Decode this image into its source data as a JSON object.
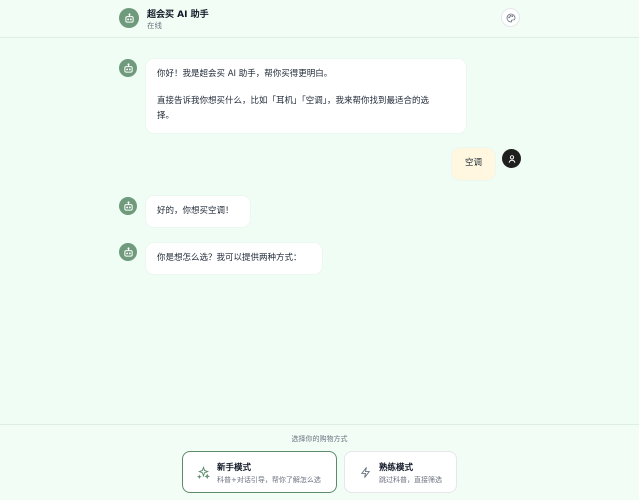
{
  "header": {
    "title": "超会买 AI 助手",
    "status": "在线"
  },
  "messages": [
    {
      "role": "assistant",
      "lines": [
        "你好！我是超会买 AI 助手，帮你买得更明白。",
        "",
        "直接告诉我你想买什么，比如「耳机」「空调」，我来帮你找到最适合的选",
        "择。"
      ]
    },
    {
      "role": "user",
      "text": "空调"
    },
    {
      "role": "assistant",
      "text": "好的，你想买空调！"
    },
    {
      "role": "assistant",
      "text": "你是想怎么选？我可以提供两种方式："
    }
  ],
  "footer": {
    "hint": "选择你的购物方式",
    "modes": [
      {
        "title": "新手模式",
        "desc": "科普+对话引导，帮你了解怎么选",
        "icon": "sparkle-icon",
        "selected": true
      },
      {
        "title": "熟练模式",
        "desc": "跳过科普，直接筛选",
        "icon": "lightning-icon",
        "selected": false
      }
    ]
  },
  "colors": {
    "background": "#f0fdf4",
    "bot_avatar": "#6f9a7c",
    "user_bubble": "#fff7e0",
    "accent_border": "#5b8a6a"
  }
}
